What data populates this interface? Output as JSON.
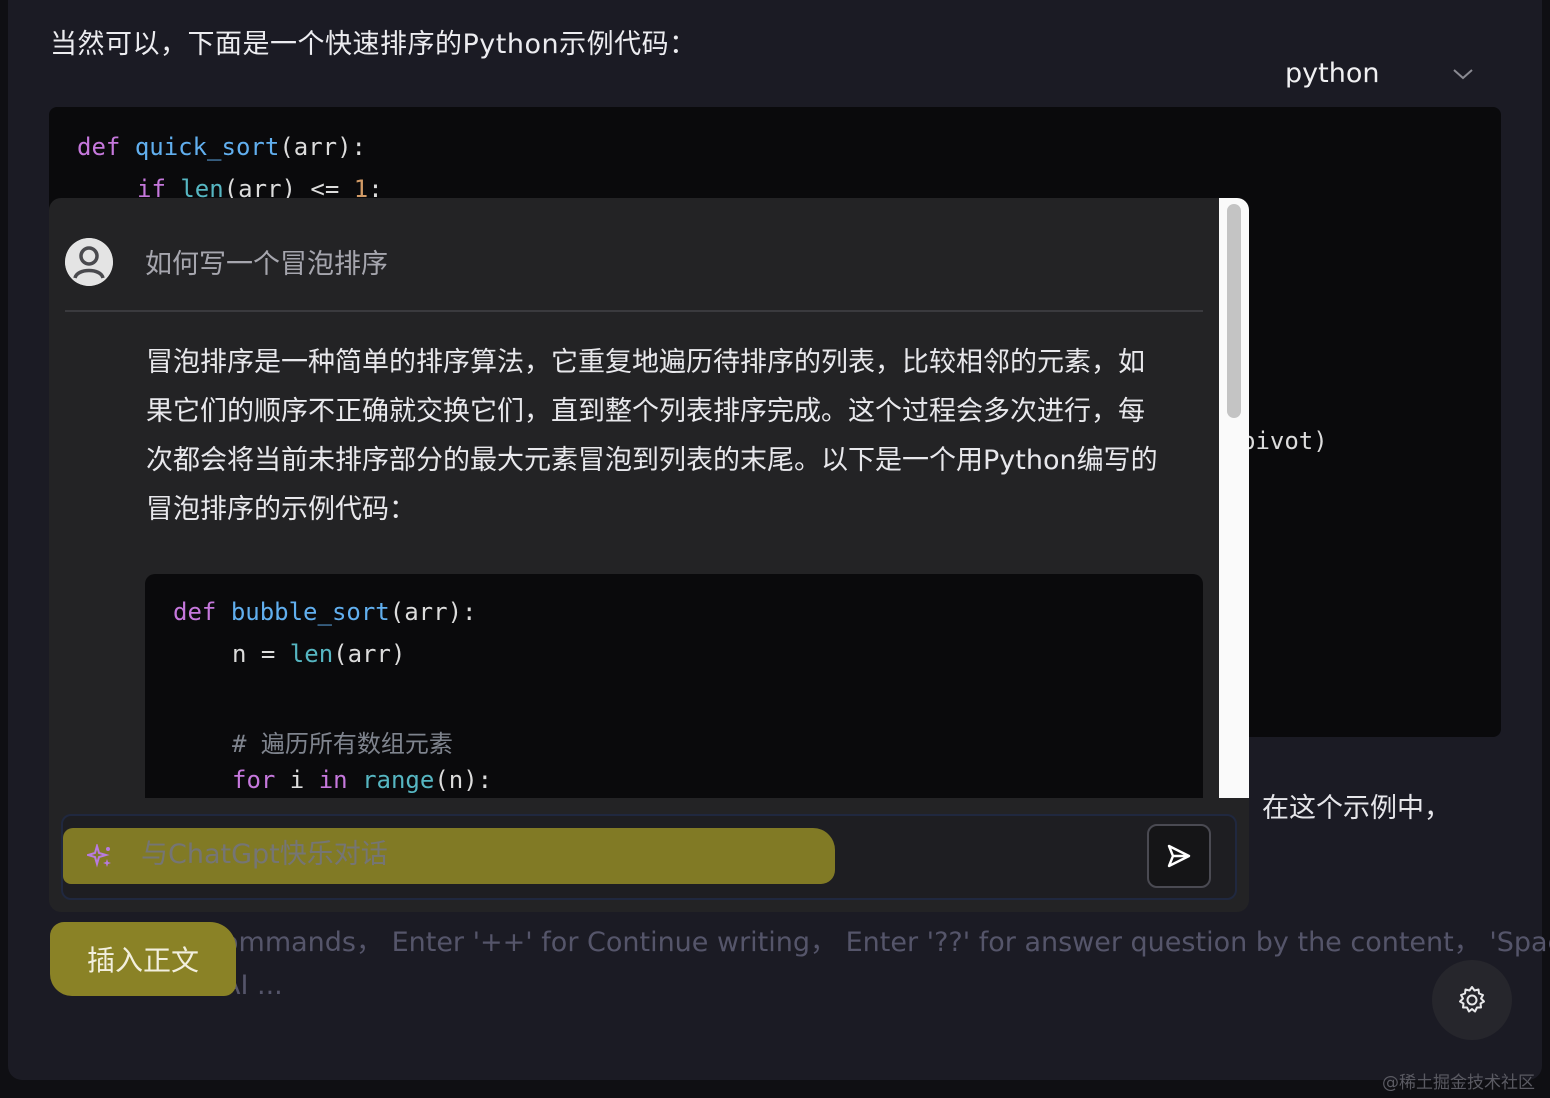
{
  "intro_text": "当然可以，下面是一个快速排序的Python示例代码：",
  "language_selector": {
    "selected": "python"
  },
  "background_code": {
    "line1": {
      "kw": "def",
      "fn": "quick_sort",
      "rest": "(arr):"
    },
    "line2": {
      "kw": "if",
      "bi": "len",
      "mid": "(arr) <= ",
      "num": "1",
      "end": ":"
    },
    "partial": "pivot)"
  },
  "after_text": "在这个示例中，",
  "hint": {
    "line1": "ommands，  Enter '++' for Continue writing，  Enter '??' for answer question by the content，  'Space'",
    "line2": "AI ..."
  },
  "popup": {
    "question": "如何写一个冒泡排序",
    "answer_lines": [
      "冒泡排序是一种简单的排序算法，它重复地遍历待排序的列表，比较相邻的元素，如",
      "果它们的顺序不正确就交换它们，直到整个列表排序完成。这个过程会多次进行，每",
      "次都会将当前未排序部分的最大元素冒泡到列表的末尾。以下是一个用Python编写的",
      "冒泡排序的示例代码："
    ],
    "code": {
      "l1": {
        "kw": "def",
        "fn": "bubble_sort",
        "rest": "(arr):"
      },
      "l2": {
        "pre": "n = ",
        "bi": "len",
        "rest": "(arr)"
      },
      "l3": {
        "comment": "# 遍历所有数组元素"
      },
      "l4": {
        "kw1": "for",
        "var": " i ",
        "kw2": "in",
        "bi": "range",
        "rest": "(n):"
      }
    }
  },
  "input": {
    "placeholder": "与ChatGpt快乐对话"
  },
  "insert_button": "插入正文",
  "watermark": "@稀土掘金技术社区"
}
